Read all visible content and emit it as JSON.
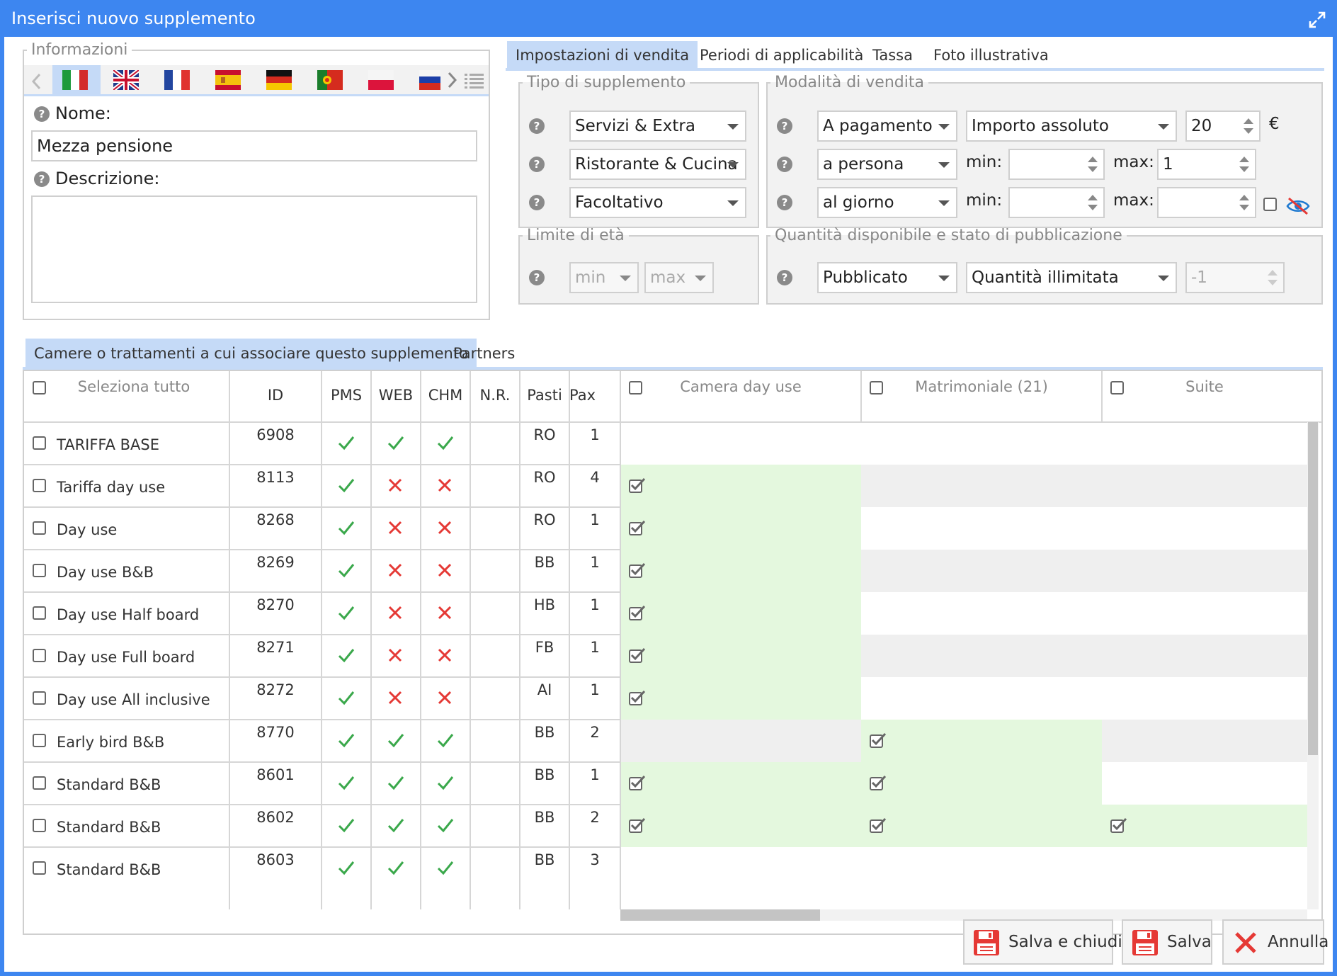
{
  "dialog": {
    "title": "Inserisci nuovo supplemento"
  },
  "info": {
    "legend": "Informazioni",
    "languages": [
      "it",
      "en",
      "fr",
      "es",
      "de",
      "pt",
      "pl",
      "ru"
    ],
    "name_label": "Nome:",
    "name_value": "Mezza pensione",
    "desc_label": "Descrizione:",
    "desc_value": ""
  },
  "settings_tabs": [
    "Impostazioni di vendita",
    "Periodi di applicabilità",
    "Tassa",
    "Foto illustrativa"
  ],
  "tipo": {
    "legend": "Tipo di supplemento",
    "selects": [
      "Servizi & Extra",
      "Ristorante & Cucina",
      "Facoltativo"
    ]
  },
  "modalita": {
    "legend": "Modalità di vendita",
    "payment": "A pagamento",
    "amount_type": "Importo assoluto",
    "amount": "20",
    "currency": "€",
    "per": "a persona",
    "per_min_label": "min:",
    "per_min": "",
    "per_max_label": "max:",
    "per_max": "1",
    "freq": "al giorno",
    "freq_min_label": "min:",
    "freq_min": "",
    "freq_max_label": "max:",
    "freq_max": ""
  },
  "eta": {
    "legend": "Limite di età",
    "min_placeholder": "min",
    "max_placeholder": "max"
  },
  "quantita": {
    "legend": "Quantità disponibile e stato di pubblicazione",
    "status": "Pubblicato",
    "qty_type": "Quantità illimitata",
    "qty": "-1"
  },
  "assoc_tabs": [
    "Camere o trattamenti a cui associare questo supplemento",
    "Partners"
  ],
  "table": {
    "select_all": "Seleziona tutto",
    "columns": [
      "ID",
      "PMS",
      "WEB",
      "CHM",
      "N.R.",
      "Pasti",
      "Pax"
    ],
    "rooms": [
      "Camera day use",
      "Matrimoniale (21)",
      "Suite"
    ],
    "rows": [
      {
        "name": "TARIFFA BASE",
        "id": "6908",
        "pms": "ok",
        "web": "ok",
        "chm": "ok",
        "nr": "",
        "pasti": "RO",
        "pax": "1",
        "rooms": [
          "",
          "",
          ""
        ]
      },
      {
        "name": "Tariffa day use",
        "id": "8113",
        "pms": "ok",
        "web": "no",
        "chm": "no",
        "nr": "",
        "pasti": "RO",
        "pax": "4",
        "rooms": [
          "checked",
          "grey",
          "grey"
        ]
      },
      {
        "name": "Day use",
        "id": "8268",
        "pms": "ok",
        "web": "no",
        "chm": "no",
        "nr": "",
        "pasti": "RO",
        "pax": "1",
        "rooms": [
          "checked",
          "",
          ""
        ]
      },
      {
        "name": "Day use B&B",
        "id": "8269",
        "pms": "ok",
        "web": "no",
        "chm": "no",
        "nr": "",
        "pasti": "BB",
        "pax": "1",
        "rooms": [
          "checked",
          "grey",
          "grey"
        ]
      },
      {
        "name": "Day use Half board",
        "id": "8270",
        "pms": "ok",
        "web": "no",
        "chm": "no",
        "nr": "",
        "pasti": "HB",
        "pax": "1",
        "rooms": [
          "checked",
          "",
          ""
        ]
      },
      {
        "name": "Day use Full board",
        "id": "8271",
        "pms": "ok",
        "web": "no",
        "chm": "no",
        "nr": "",
        "pasti": "FB",
        "pax": "1",
        "rooms": [
          "checked",
          "grey",
          "grey"
        ]
      },
      {
        "name": "Day use All inclusive",
        "id": "8272",
        "pms": "ok",
        "web": "no",
        "chm": "no",
        "nr": "",
        "pasti": "AI",
        "pax": "1",
        "rooms": [
          "checked",
          "",
          ""
        ]
      },
      {
        "name": "Early bird B&B",
        "id": "8770",
        "pms": "ok",
        "web": "ok",
        "chm": "ok",
        "nr": "",
        "pasti": "BB",
        "pax": "2",
        "rooms": [
          "grey",
          "checked",
          "grey"
        ]
      },
      {
        "name": "Standard B&B",
        "id": "8601",
        "pms": "ok",
        "web": "ok",
        "chm": "ok",
        "nr": "",
        "pasti": "BB",
        "pax": "1",
        "rooms": [
          "checked",
          "checked",
          ""
        ]
      },
      {
        "name": "Standard B&B",
        "id": "8602",
        "pms": "ok",
        "web": "ok",
        "chm": "ok",
        "nr": "",
        "pasti": "BB",
        "pax": "2",
        "rooms": [
          "checked",
          "checked",
          "checked"
        ]
      },
      {
        "name": "Standard B&B",
        "id": "8603",
        "pms": "ok",
        "web": "ok",
        "chm": "ok",
        "nr": "",
        "pasti": "BB",
        "pax": "3",
        "rooms": [
          "",
          "",
          ""
        ]
      }
    ]
  },
  "buttons": {
    "save_close": "Salva e chiudi",
    "save": "Salva",
    "cancel": "Annulla"
  },
  "colors": {
    "accent": "#3d86f0",
    "ok": "#3aa84b",
    "no": "#e53935",
    "cell_green": "#e4f8de",
    "cell_grey": "#efefef"
  }
}
